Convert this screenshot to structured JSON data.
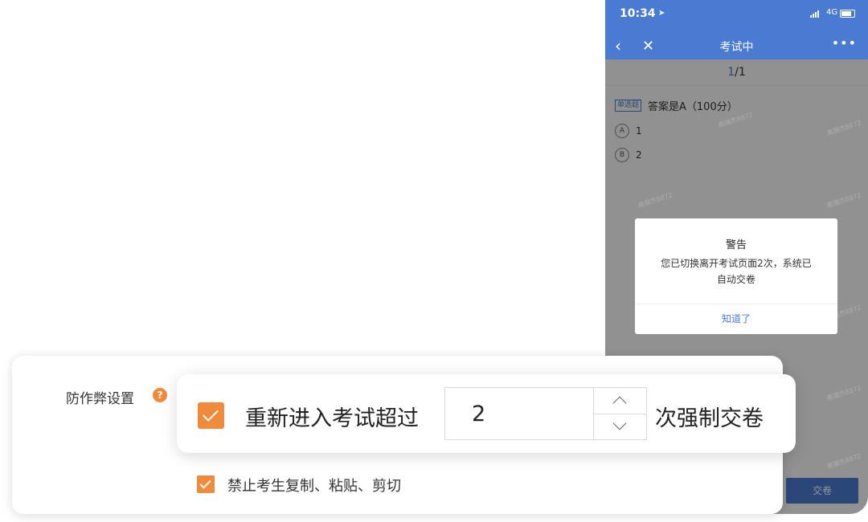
{
  "phone": {
    "status_bar": {
      "time": "10:34",
      "network": "4G"
    },
    "nav": {
      "title": "考试中"
    },
    "pager": {
      "current": "1",
      "total": "/1"
    },
    "question": {
      "type_tag": "单选题",
      "text": "答案是A（100分）",
      "options": [
        {
          "letter": "A",
          "text": "1"
        },
        {
          "letter": "B",
          "text": "2"
        }
      ]
    },
    "watermark": "高瑞杰8872",
    "submit_label": "交卷",
    "dialog": {
      "title": "警告",
      "message_line1": "您已切换离开考试页面2次，系统已",
      "message_line2": "自动交卷",
      "button": "知道了"
    }
  },
  "settings": {
    "label": "防作弊设置",
    "reenter": {
      "checked": true,
      "prefix": "重新进入考试超过",
      "value": "2",
      "suffix": "次强制交卷"
    },
    "no_copy": {
      "checked": true,
      "label": "禁止考生复制、粘贴、剪切"
    }
  },
  "colors": {
    "primary": "#4a7bd2",
    "accent": "#f08a3c"
  }
}
